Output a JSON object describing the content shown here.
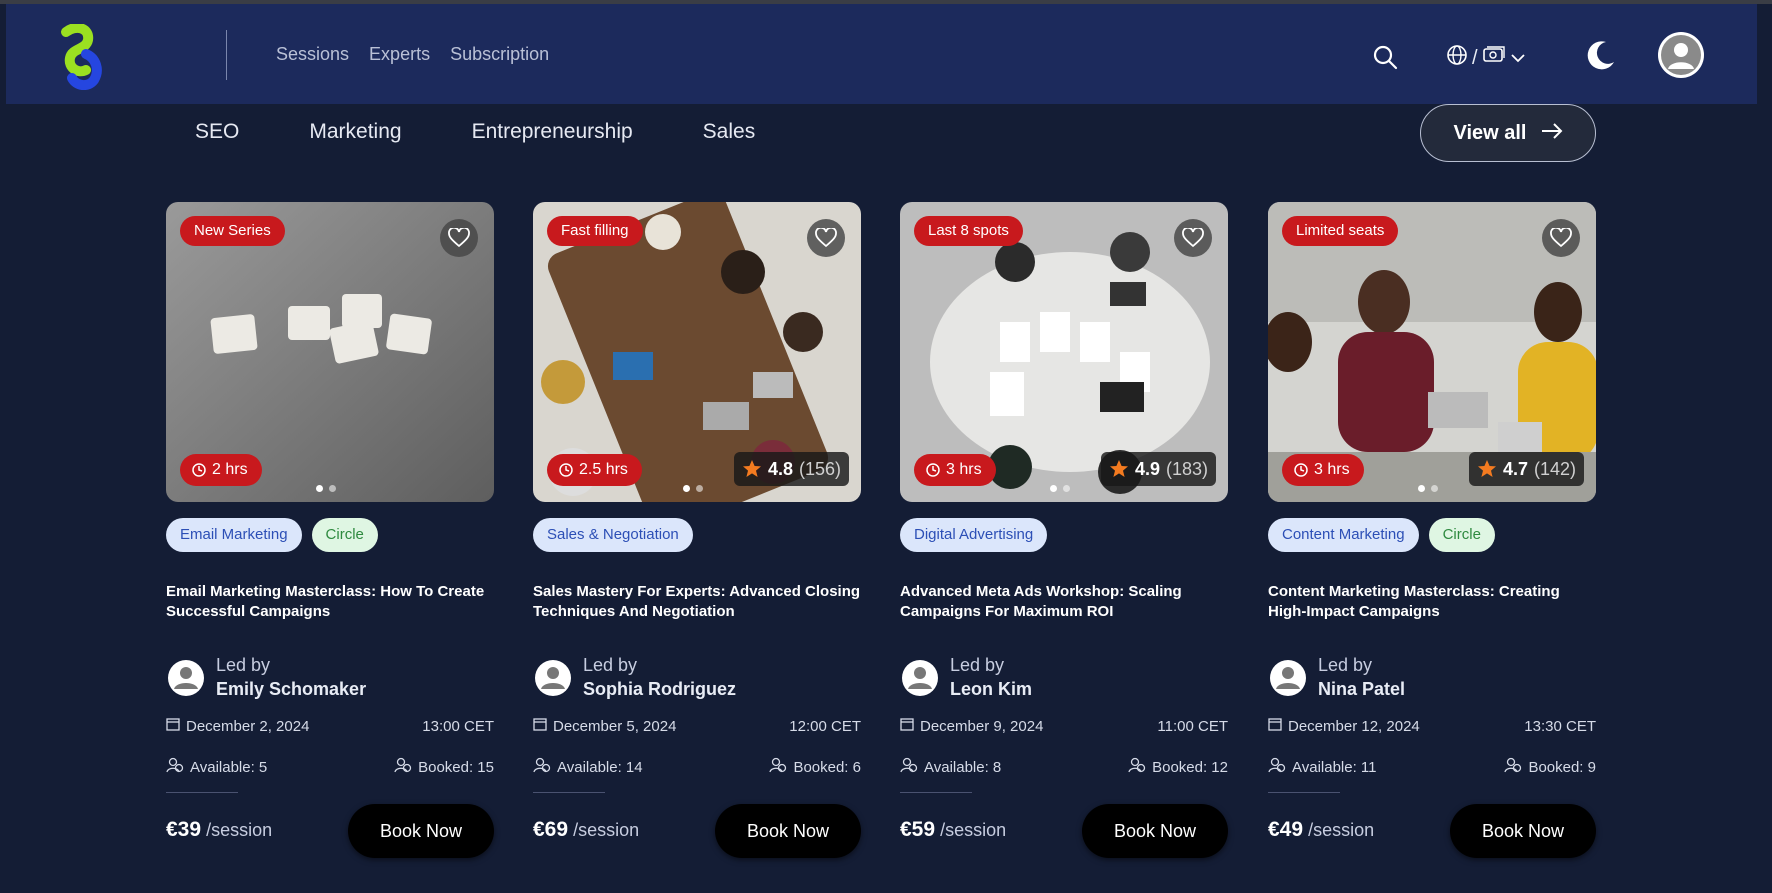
{
  "nav": {
    "links": [
      "Sessions",
      "Experts",
      "Subscription"
    ],
    "lang_separator": "/"
  },
  "categories": [
    "SEO",
    "Marketing",
    "Entrepreneurship",
    "Sales"
  ],
  "view_all_label": "View all",
  "colors": {
    "navbar": "#1c2a5c",
    "background": "#141d35",
    "accent_red": "#c8191d"
  },
  "cards": [
    {
      "badge": "New Series",
      "duration": "2 hrs",
      "rating": null,
      "tags": [
        {
          "label": "Email Marketing",
          "kind": "blue"
        },
        {
          "label": "Circle",
          "kind": "green"
        }
      ],
      "title": "Email Marketing Masterclass: How To Create Successful Campaigns",
      "led_by_label": "Led by",
      "host": "Emily Schomaker",
      "date": "December 2, 2024",
      "time": "13:00 CET",
      "available": "Available: 5",
      "booked": "Booked: 15",
      "price": "€39",
      "per": "/session",
      "cta": "Book Now"
    },
    {
      "badge": "Fast filling",
      "duration": "2.5 hrs",
      "rating": {
        "score": "4.8",
        "count": "(156)"
      },
      "tags": [
        {
          "label": "Sales & Negotiation",
          "kind": "blue"
        }
      ],
      "title": "Sales Mastery For Experts: Advanced Closing Techniques And Negotiation",
      "led_by_label": "Led by",
      "host": "Sophia Rodriguez",
      "date": "December 5, 2024",
      "time": "12:00 CET",
      "available": "Available: 14",
      "booked": "Booked: 6",
      "price": "€69",
      "per": "/session",
      "cta": "Book Now"
    },
    {
      "badge": "Last 8 spots",
      "duration": "3 hrs",
      "rating": {
        "score": "4.9",
        "count": "(183)"
      },
      "tags": [
        {
          "label": "Digital Advertising",
          "kind": "blue"
        }
      ],
      "title": "Advanced Meta Ads Workshop: Scaling Campaigns For Maximum ROI",
      "led_by_label": "Led by",
      "host": "Leon Kim",
      "date": "December 9, 2024",
      "time": "11:00 CET",
      "available": "Available: 8",
      "booked": "Booked: 12",
      "price": "€59",
      "per": "/session",
      "cta": "Book Now"
    },
    {
      "badge": "Limited seats",
      "duration": "3 hrs",
      "rating": {
        "score": "4.7",
        "count": "(142)"
      },
      "tags": [
        {
          "label": "Content Marketing",
          "kind": "blue"
        },
        {
          "label": "Circle",
          "kind": "green"
        }
      ],
      "title": "Content Marketing Masterclass: Creating High-Impact Campaigns",
      "led_by_label": "Led by",
      "host": "Nina Patel",
      "date": "December 12, 2024",
      "time": "13:30 CET",
      "available": "Available: 11",
      "booked": "Booked: 9",
      "price": "€49",
      "per": "/session",
      "cta": "Book Now"
    }
  ]
}
